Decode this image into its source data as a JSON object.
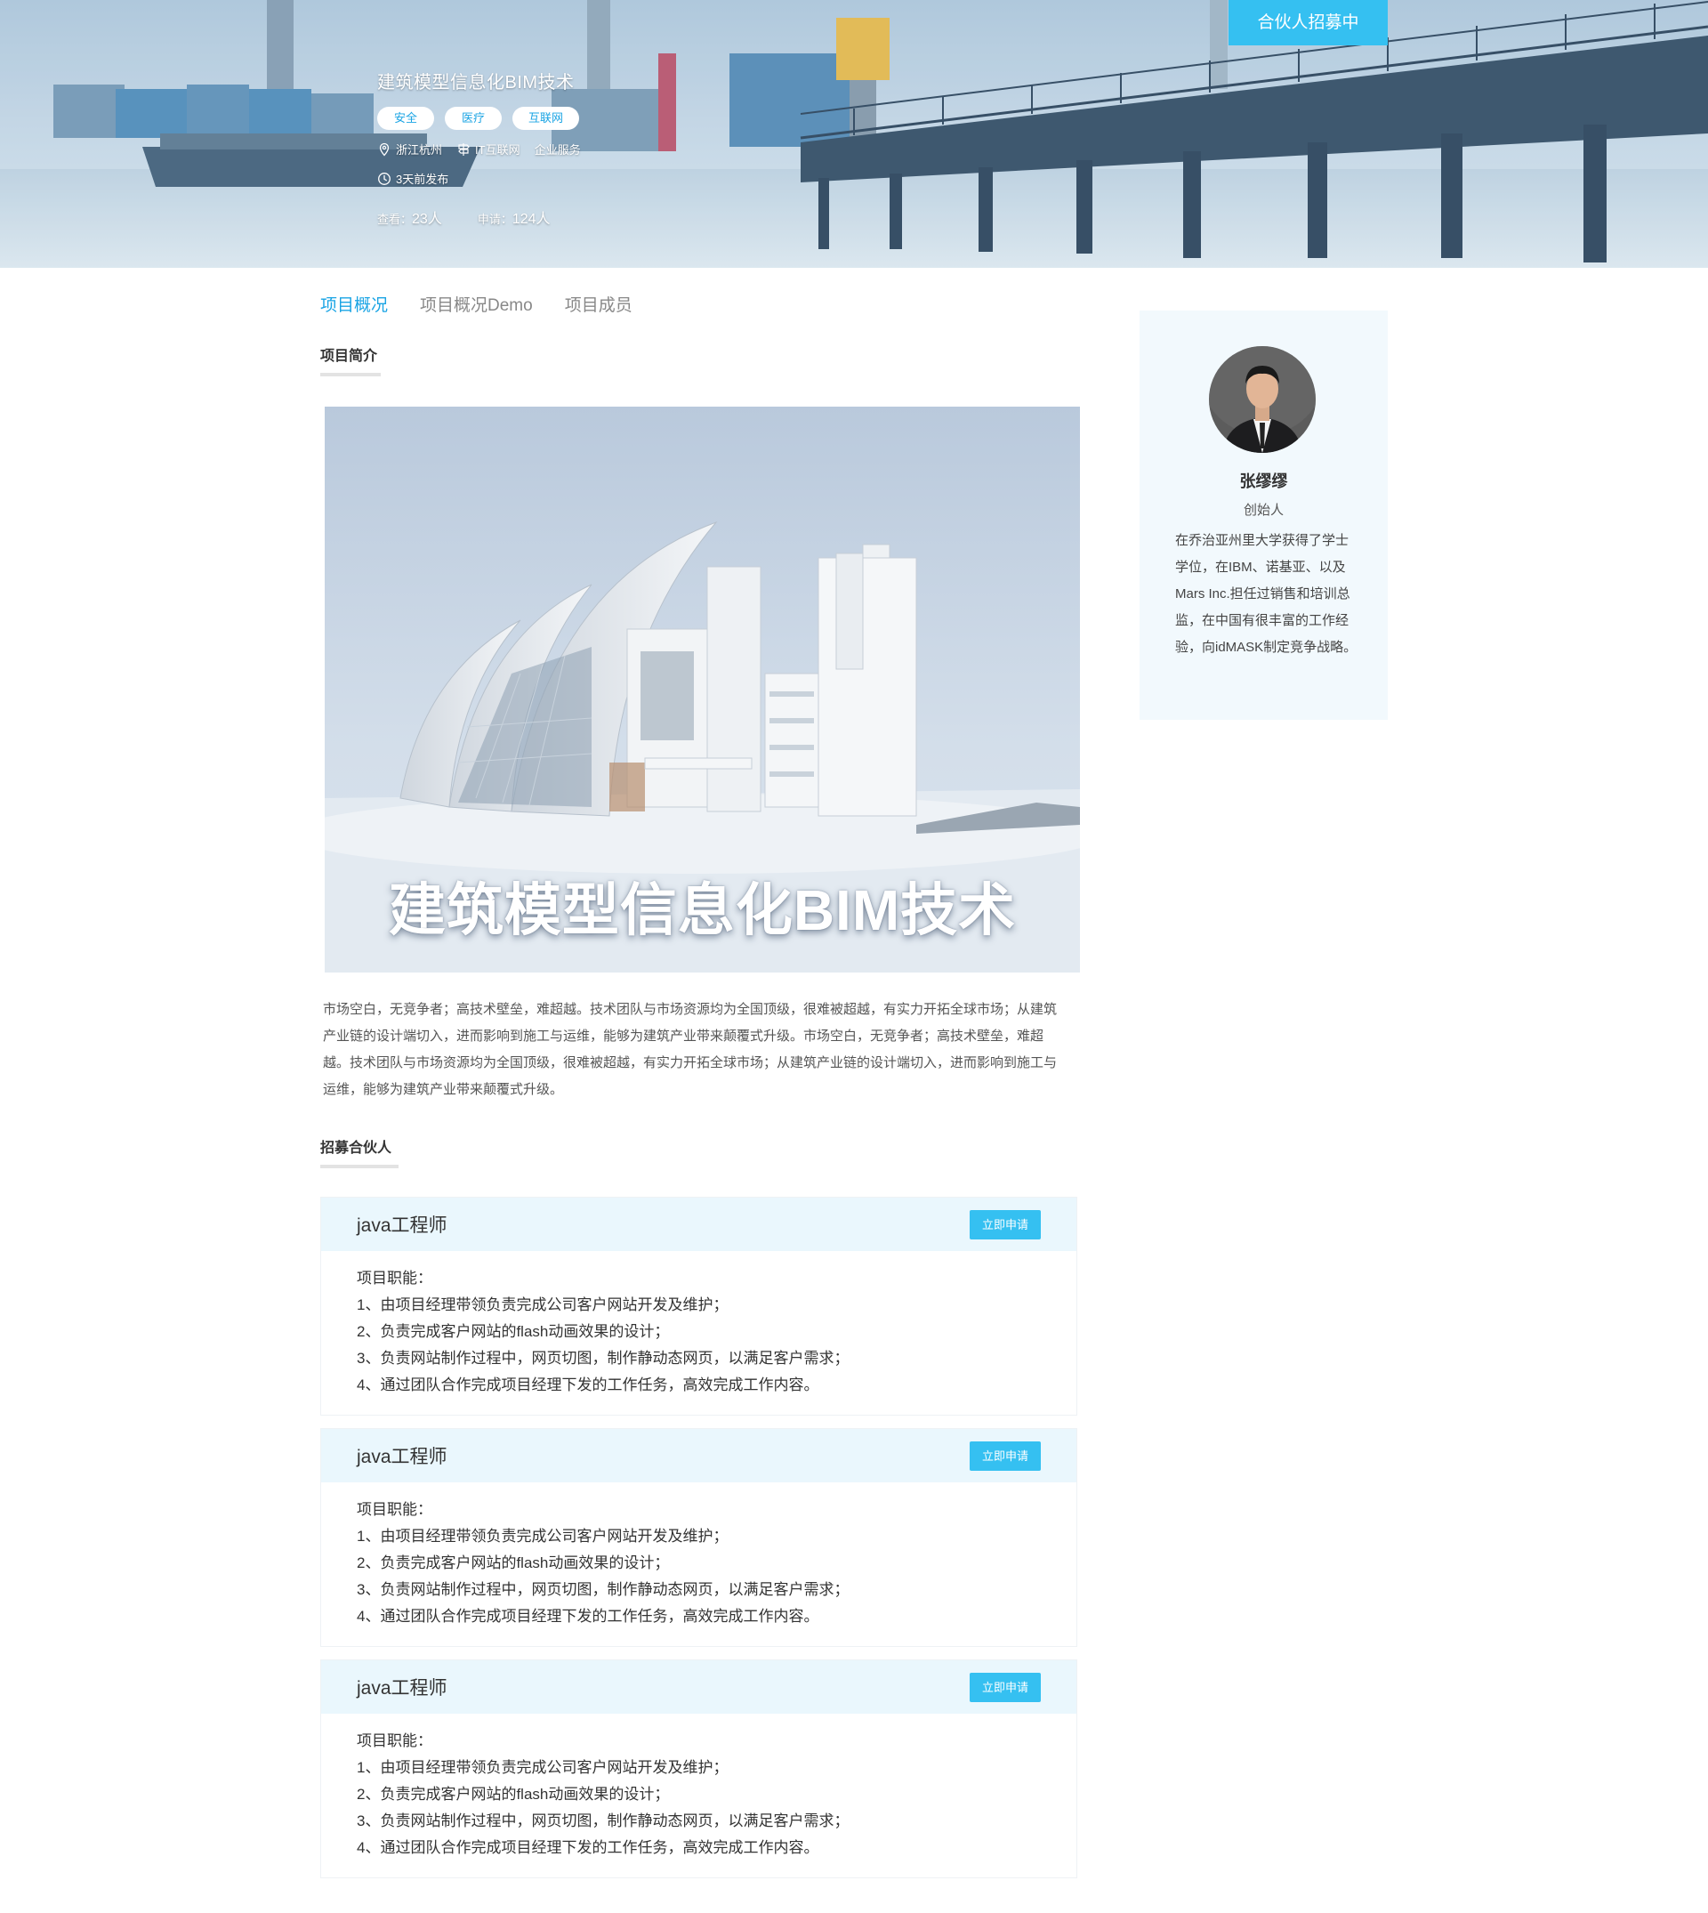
{
  "hero": {
    "title": "建筑模型信息化BIM技术",
    "tags": [
      "安全",
      "医疗",
      "互联网"
    ],
    "location": "浙江杭州",
    "industry": "IT互联网",
    "category": "企业服务",
    "posted": "3天前发布",
    "views_label": "查看：",
    "views_value": "23人",
    "applies_label": "申请：",
    "applies_value": "124人",
    "recruit_button": "合伙人招募中"
  },
  "tabs": [
    "项目概况",
    "项目概况Demo",
    "项目成员"
  ],
  "active_tab": 0,
  "sections": {
    "intro_heading": "项目简介",
    "recruit_heading": "招募合伙人"
  },
  "main_image": {
    "overlay_title": "建筑模型信息化BIM技术"
  },
  "intro_text": "市场空白，无竞争者；高技术壁垒，难超越。技术团队与市场资源均为全国顶级，很难被超越，有实力开拓全球市场；从建筑产业链的设计端切入，进而影响到施工与运维，能够为建筑产业带来颠覆式升级。市场空白，无竞争者；高技术壁垒，难超越。技术团队与市场资源均为全国顶级，很难被超越，有实力开拓全球市场；从建筑产业链的设计端切入，进而影响到施工与运维，能够为建筑产业带来颠覆式升级。",
  "jobs": [
    {
      "title": "java工程师",
      "apply_label": "立即申请",
      "duties_label": "项目职能：",
      "duties": [
        "1、由项目经理带领负责完成公司客户网站开发及维护；",
        "2、负责完成客户网站的flash动画效果的设计；",
        "3、负责网站制作过程中，网页切图，制作静动态网页，以满足客户需求；",
        "4、通过团队合作完成项目经理下发的工作任务，高效完成工作内容。"
      ]
    },
    {
      "title": "java工程师",
      "apply_label": "立即申请",
      "duties_label": "项目职能：",
      "duties": [
        "1、由项目经理带领负责完成公司客户网站开发及维护；",
        "2、负责完成客户网站的flash动画效果的设计；",
        "3、负责网站制作过程中，网页切图，制作静动态网页，以满足客户需求；",
        "4、通过团队合作完成项目经理下发的工作任务，高效完成工作内容。"
      ]
    },
    {
      "title": "java工程师",
      "apply_label": "立即申请",
      "duties_label": "项目职能：",
      "duties": [
        "1、由项目经理带领负责完成公司客户网站开发及维护；",
        "2、负责完成客户网站的flash动画效果的设计；",
        "3、负责网站制作过程中，网页切图，制作静动态网页，以满足客户需求；",
        "4、通过团队合作完成项目经理下发的工作任务，高效完成工作内容。"
      ]
    }
  ],
  "profile": {
    "name": "张缪缪",
    "role": "创始人",
    "bio": "在乔治亚州里大学获得了学士学位，在IBM、诺基亚、以及Mars Inc.担任过销售和培训总监，在中国有很丰富的工作经验，向idMASK制定竞争战略。"
  },
  "colors": {
    "accent": "#1aa4e4",
    "button": "#35c0f1",
    "job_header_bg": "#eaf7fd",
    "profile_bg": "#f2f9fd"
  }
}
